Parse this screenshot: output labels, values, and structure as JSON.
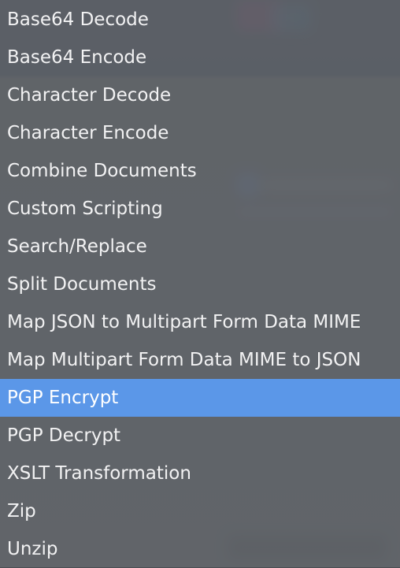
{
  "menu": {
    "items": [
      {
        "label": "Base64 Decode",
        "selected": false
      },
      {
        "label": "Base64 Encode",
        "selected": false
      },
      {
        "label": "Character Decode",
        "selected": false
      },
      {
        "label": "Character Encode",
        "selected": false
      },
      {
        "label": "Combine Documents",
        "selected": false
      },
      {
        "label": "Custom Scripting",
        "selected": false
      },
      {
        "label": "Search/Replace",
        "selected": false
      },
      {
        "label": "Split Documents",
        "selected": false
      },
      {
        "label": "Map JSON to Multipart Form Data MIME",
        "selected": false
      },
      {
        "label": "Map Multipart Form Data MIME to JSON",
        "selected": false
      },
      {
        "label": "PGP Encrypt",
        "selected": true
      },
      {
        "label": "PGP Decrypt",
        "selected": false
      },
      {
        "label": "XSLT Transformation",
        "selected": false
      },
      {
        "label": "Zip",
        "selected": false
      },
      {
        "label": "Unzip",
        "selected": false
      }
    ],
    "colors": {
      "highlight": "#5b97e8",
      "text": "#f2f2f3",
      "background": "#62656a"
    }
  }
}
